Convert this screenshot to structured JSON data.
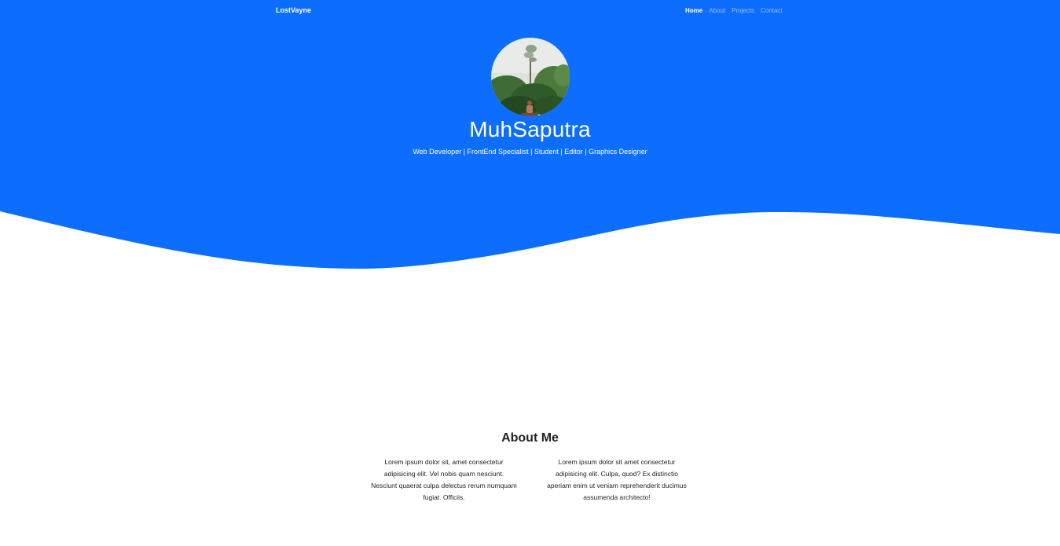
{
  "navbar": {
    "brand": "LostVayne",
    "links": [
      {
        "label": "Home",
        "active": true
      },
      {
        "label": "About",
        "active": false
      },
      {
        "label": "Projects",
        "active": false
      },
      {
        "label": "Contact",
        "active": false
      }
    ]
  },
  "hero": {
    "name": "MuhSaputra",
    "tagline": "Web Developer | FrontEnd Specialist | Student | Editor | Graphics Designer"
  },
  "about": {
    "title": "About Me",
    "paragraphs": [
      "Lorem ipsum dolor sit, amet consectetur adipisicing elit. Vel nobis quam nesciunt. Nesciunt quaerat culpa delectus rerum numquam fugiat. Officiis.",
      "Lorem ipsum dolor sit amet consectetur adipisicing elit. Culpa, quod? Ex distinctio aperiam enim ut veniam reprehenderit ducimus assumenda architecto!"
    ]
  },
  "colors": {
    "primary": "#0d6efd",
    "text": "#212529",
    "background": "#ffffff"
  }
}
